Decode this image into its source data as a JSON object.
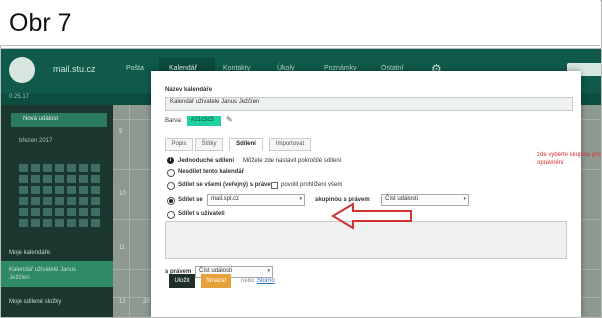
{
  "figure": {
    "caption": "Obr 7"
  },
  "app": {
    "site_name": "mail.stu.cz",
    "nav": [
      "Pošta",
      "Kalendář",
      "Kontakty",
      "Úkoly",
      "Poznámky",
      "Ostatní"
    ],
    "active_nav_index": 1,
    "sub_bar": "0.25.17",
    "new_event_label": "Nová událost",
    "mini_calendar_month": "březen 2017",
    "sidebar_sections": {
      "my_calendars": "Moje kalendáře",
      "calendar_item": "Kalendář uživatele Janus Ježčíen",
      "shared": "Moje sdílené složky"
    },
    "week_numbers": [
      "9",
      "10",
      "11",
      "12"
    ],
    "day_numbers_row_last": [
      "20",
      "21",
      "22",
      "23",
      "24",
      "25",
      "26"
    ]
  },
  "dialog": {
    "name_label": "Název kalendáře",
    "name_value": "Kalendář uživatele Janus Ježčíen",
    "color_label": "Barva:",
    "color_value": "#21c5c5",
    "color_swatch": "#20d0a0",
    "tabs": [
      "Popis",
      "Štítky",
      "Sdílení",
      "Importovat"
    ],
    "active_tab_index": 2,
    "options": {
      "simple_prefix": "Jednoduché sdílení",
      "simple_text": "Můžete zde nastavit pokročilé sdílení",
      "dont_share": "Nesdílet tento kalendář",
      "share_everyone": "Sdílet se všemi (veřejný) s právem",
      "allow_public": "povolit prohlížení všem",
      "share_with": "Sdílet se",
      "share_with_value": "mail.spl.cz",
      "group_label": "skupinou s právem",
      "group_value": "Číst události",
      "share_user": "Sdílet s uživateli"
    },
    "rights_label": "s právem",
    "rights_value": "Číst události",
    "note": "zde vyberte skupinu pro sdílení a nastavte oprávnění",
    "note_color": "#d43030",
    "buttons": {
      "save": "Uložit",
      "delete": "Smazat",
      "or": "nebo",
      "cancel": "Storno"
    }
  }
}
